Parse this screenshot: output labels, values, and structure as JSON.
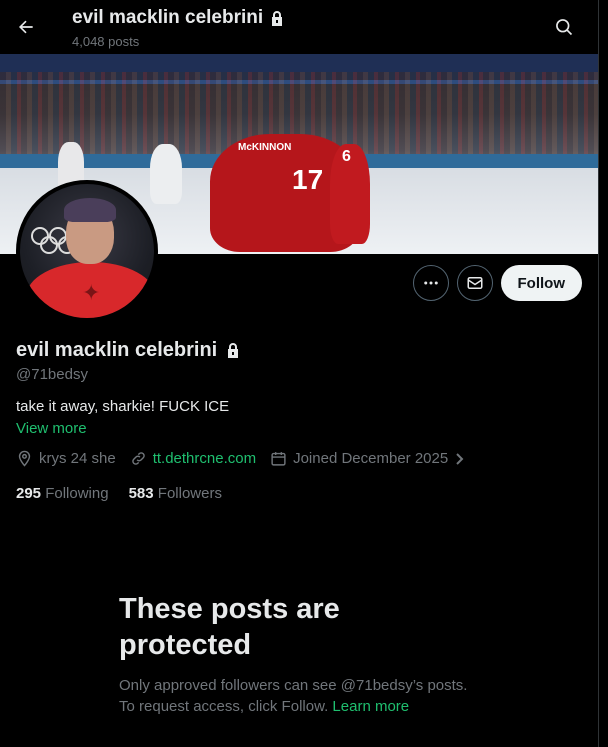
{
  "header": {
    "title": "evil macklin celebrini",
    "posts_count": "4,048 posts"
  },
  "banner": {
    "jersey_text_1": "McKINNON",
    "jersey_number_1": "17",
    "jersey_number_2": "6"
  },
  "profile": {
    "display_name": "evil macklin celebrini",
    "handle": "@71bedsy",
    "bio": "take it away, sharkie! FUCK ICE",
    "view_more": "View more",
    "location": "krys 24 she",
    "website": "tt.dethrcne.com",
    "joined": "Joined December 2025",
    "following_count": "295",
    "following_label": "Following",
    "followers_count": "583",
    "followers_label": "Followers"
  },
  "actions": {
    "follow_label": "Follow"
  },
  "protected": {
    "heading_line1": "These posts are",
    "heading_line2": "protected",
    "line1": "Only approved followers can see @71bedsy’s posts.",
    "line2_prefix": "To request access, click Follow.",
    "learn_more": "Learn more"
  },
  "colors": {
    "background": "#000000",
    "accent_link": "#1fbf6f",
    "text_primary": "#e7e9ea",
    "text_secondary": "#71767b"
  }
}
